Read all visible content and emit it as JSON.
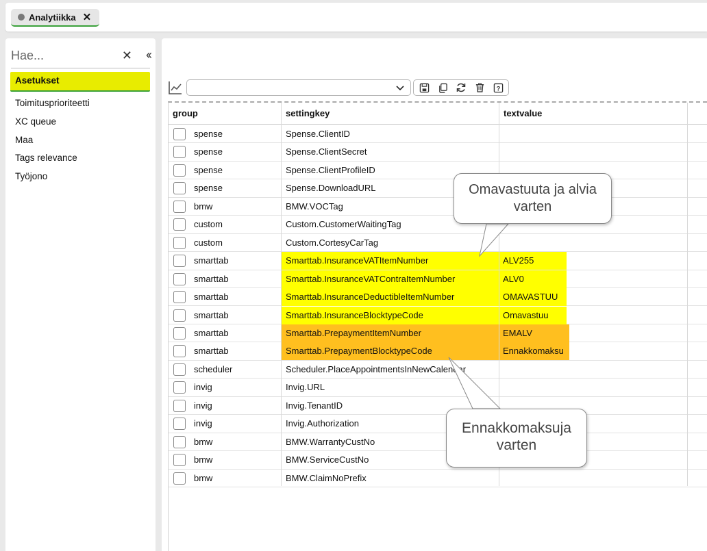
{
  "tabs": [
    {
      "label": "Analytiikka"
    }
  ],
  "sidebar": {
    "search_placeholder": "Hae...",
    "items": [
      {
        "label": "Asetukset",
        "active": true
      },
      {
        "label": "Toimitusprioriteetti"
      },
      {
        "label": "XC queue"
      },
      {
        "label": "Maa"
      },
      {
        "label": "Tags relevance"
      },
      {
        "label": "Työjono"
      }
    ]
  },
  "toolbar": {
    "combo_value": "",
    "buttons": [
      "save-icon",
      "copy-icon",
      "refresh-icon",
      "delete-icon",
      "help-icon"
    ]
  },
  "grid": {
    "columns": [
      "group",
      "settingkey",
      "textvalue"
    ],
    "rows": [
      {
        "group": "spense",
        "settingkey": "Spense.ClientID",
        "textvalue": ""
      },
      {
        "group": "spense",
        "settingkey": "Spense.ClientSecret",
        "textvalue": ""
      },
      {
        "group": "spense",
        "settingkey": "Spense.ClientProfileID",
        "textvalue": ""
      },
      {
        "group": "spense",
        "settingkey": "Spense.DownloadURL",
        "textvalue": ""
      },
      {
        "group": "bmw",
        "settingkey": "BMW.VOCTag",
        "textvalue": ""
      },
      {
        "group": "custom",
        "settingkey": "Custom.CustomerWaitingTag",
        "textvalue": ""
      },
      {
        "group": "custom",
        "settingkey": "Custom.CortesyCarTag",
        "textvalue": ""
      },
      {
        "group": "smarttab",
        "settingkey": "Smarttab.InsuranceVATItemNumber",
        "textvalue": "ALV255",
        "highlight": "yellow"
      },
      {
        "group": "smarttab",
        "settingkey": "Smarttab.InsuranceVATContraItemNumber",
        "textvalue": "ALV0",
        "highlight": "yellow"
      },
      {
        "group": "smarttab",
        "settingkey": "Smarttab.InsuranceDeductibleItemNumber",
        "textvalue": "OMAVASTUU",
        "highlight": "yellow"
      },
      {
        "group": "smarttab",
        "settingkey": "Smarttab.InsuranceBlocktypeCode",
        "textvalue": "Omavastuu",
        "highlight": "yellow"
      },
      {
        "group": "smarttab",
        "settingkey": "Smarttab.PrepaymentItemNumber",
        "textvalue": "EMALV",
        "highlight": "orange"
      },
      {
        "group": "smarttab",
        "settingkey": "Smarttab.PrepaymentBlocktypeCode",
        "textvalue": "Ennakkomaksu",
        "highlight": "orange"
      },
      {
        "group": "scheduler",
        "settingkey": "Scheduler.PlaceAppointmentsInNewCalendar",
        "textvalue": ""
      },
      {
        "group": "invig",
        "settingkey": "Invig.URL",
        "textvalue": ""
      },
      {
        "group": "invig",
        "settingkey": "Invig.TenantID",
        "textvalue": ""
      },
      {
        "group": "invig",
        "settingkey": "Invig.Authorization",
        "textvalue": ""
      },
      {
        "group": "bmw",
        "settingkey": "BMW.WarrantyCustNo",
        "textvalue": ""
      },
      {
        "group": "bmw",
        "settingkey": "BMW.ServiceCustNo",
        "textvalue": ""
      },
      {
        "group": "bmw",
        "settingkey": "BMW.ClaimNoPrefix",
        "textvalue": ""
      }
    ]
  },
  "callouts": [
    {
      "lines": [
        "Omavastuuta ja alvia",
        "varten"
      ]
    },
    {
      "lines": [
        "Ennakkomaksuja",
        "varten"
      ]
    }
  ],
  "colors": {
    "highlight_yellow": "#ffff00",
    "highlight_orange": "#ffbf1f",
    "active_nav": "#e8ec00",
    "accent_green": "#3aa13a"
  }
}
